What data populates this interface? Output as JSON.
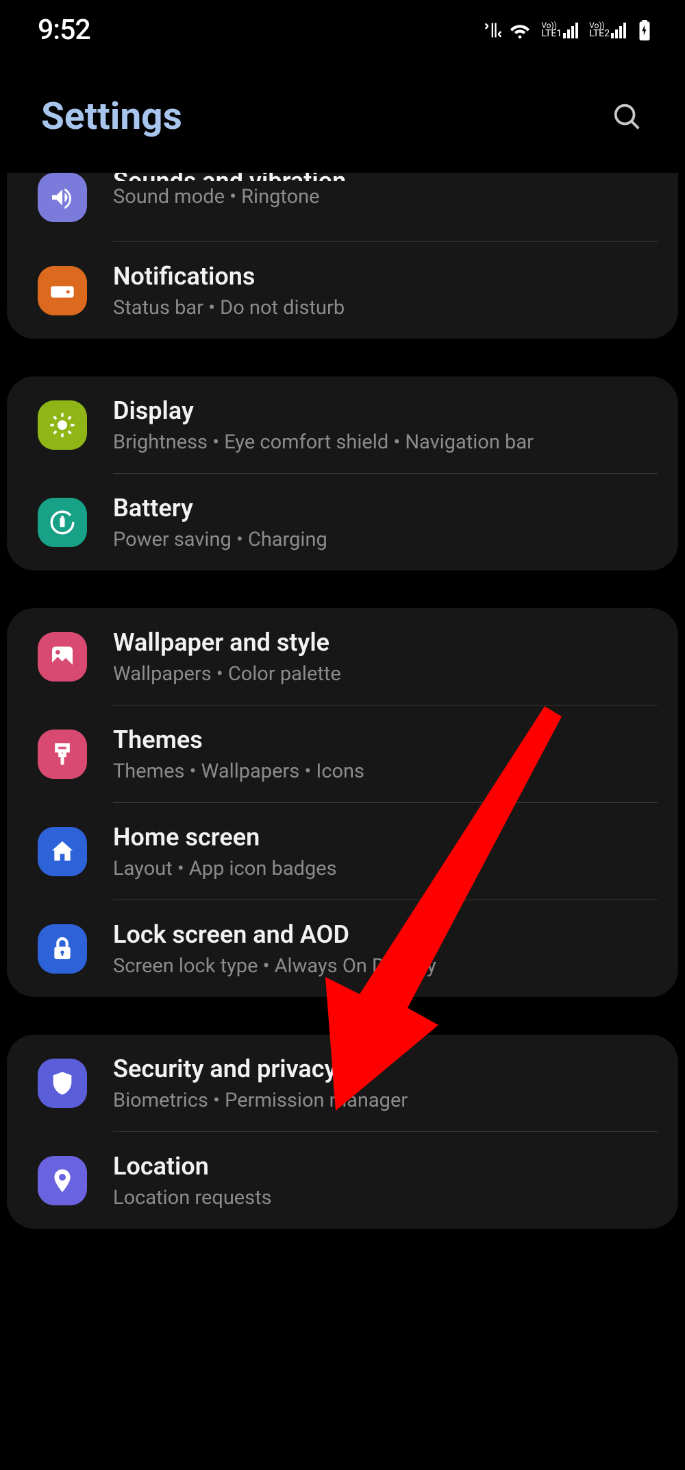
{
  "statusbar": {
    "time": "9:52",
    "lte1": "LTE1",
    "lte2": "LTE2",
    "vo": "Vo))"
  },
  "header": {
    "title": "Settings"
  },
  "group1": {
    "sounds": {
      "title": "Sounds and vibration",
      "sub": "Sound mode  •  Ringtone"
    },
    "notifications": {
      "title": "Notifications",
      "sub": "Status bar  •  Do not disturb"
    }
  },
  "group2": {
    "display": {
      "title": "Display",
      "sub": "Brightness  •  Eye comfort shield  •  Navigation bar"
    },
    "battery": {
      "title": "Battery",
      "sub": "Power saving  •  Charging"
    }
  },
  "group3": {
    "wallpaper": {
      "title": "Wallpaper and style",
      "sub": "Wallpapers  •  Color palette"
    },
    "themes": {
      "title": "Themes",
      "sub": "Themes  •  Wallpapers  •  Icons"
    },
    "home": {
      "title": "Home screen",
      "sub": "Layout  •  App icon badges"
    },
    "lock": {
      "title": "Lock screen and AOD",
      "sub": "Screen lock type  •  Always On Display"
    }
  },
  "group4": {
    "security": {
      "title": "Security and privacy",
      "sub": "Biometrics  •  Permission manager"
    },
    "location": {
      "title": "Location",
      "sub": "Location requests"
    }
  }
}
